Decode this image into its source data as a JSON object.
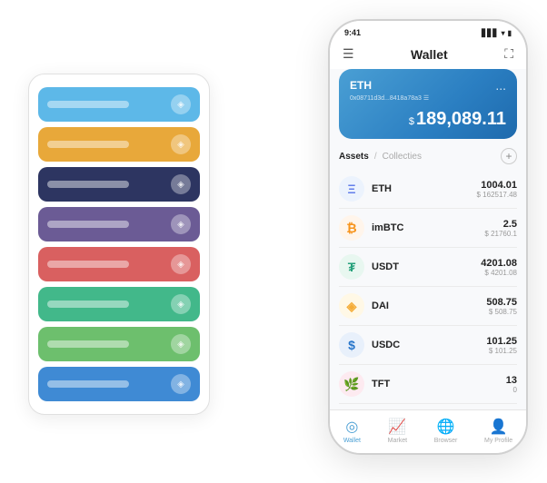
{
  "scene": {
    "background": "#ffffff"
  },
  "cardStack": {
    "cards": [
      {
        "color": "#5db8e8",
        "label": "",
        "iconChar": "◈"
      },
      {
        "color": "#e8a83a",
        "label": "",
        "iconChar": "◈"
      },
      {
        "color": "#2d3561",
        "label": "",
        "iconChar": "◈"
      },
      {
        "color": "#6b5b95",
        "label": "",
        "iconChar": "◈"
      },
      {
        "color": "#d96060",
        "label": "",
        "iconChar": "◈"
      },
      {
        "color": "#42b88a",
        "label": "",
        "iconChar": "◈"
      },
      {
        "color": "#6dbf6d",
        "label": "",
        "iconChar": "◈"
      },
      {
        "color": "#3f8ad4",
        "label": "",
        "iconChar": "◈"
      }
    ]
  },
  "phone": {
    "statusBar": {
      "time": "9:41",
      "signal": "▋▋▋",
      "wifi": "WiFi",
      "battery": "🔋"
    },
    "header": {
      "menuIcon": "☰",
      "title": "Wallet",
      "expandIcon": "⛶"
    },
    "ethCard": {
      "name": "ETH",
      "address": "0x08711d3d...8418a78a3 ☰",
      "currencySymbol": "$",
      "balance": "189,089.11",
      "dotsIcon": "..."
    },
    "assetsSection": {
      "activeTab": "Assets",
      "divider": "/",
      "inactiveTab": "Collecties",
      "addIcon": "+"
    },
    "assets": [
      {
        "name": "ETH",
        "iconBg": "#ecf3fd",
        "iconColor": "#627EEA",
        "iconChar": "Ξ",
        "amountMain": "1004.01",
        "amountUsd": "$ 162517.48"
      },
      {
        "name": "imBTC",
        "iconBg": "#fff5eb",
        "iconColor": "#F7931A",
        "iconChar": "₿",
        "amountMain": "2.5",
        "amountUsd": "$ 21760.1"
      },
      {
        "name": "USDT",
        "iconBg": "#e8f7f0",
        "iconColor": "#26A17B",
        "iconChar": "₮",
        "amountMain": "4201.08",
        "amountUsd": "$ 4201.08"
      },
      {
        "name": "DAI",
        "iconBg": "#fff8e6",
        "iconColor": "#F5AC37",
        "iconChar": "◈",
        "amountMain": "508.75",
        "amountUsd": "$ 508.75"
      },
      {
        "name": "USDC",
        "iconBg": "#e8f0fb",
        "iconColor": "#2775CA",
        "iconChar": "$",
        "amountMain": "101.25",
        "amountUsd": "$ 101.25"
      },
      {
        "name": "TFT",
        "iconBg": "#fdeaf0",
        "iconColor": "#e85d8a",
        "iconChar": "🌿",
        "amountMain": "13",
        "amountUsd": "0"
      }
    ],
    "nav": [
      {
        "id": "wallet",
        "label": "Wallet",
        "icon": "◎",
        "active": true
      },
      {
        "id": "market",
        "label": "Market",
        "icon": "📈",
        "active": false
      },
      {
        "id": "browser",
        "label": "Browser",
        "icon": "🌐",
        "active": false
      },
      {
        "id": "profile",
        "label": "My Profile",
        "icon": "👤",
        "active": false
      }
    ]
  }
}
